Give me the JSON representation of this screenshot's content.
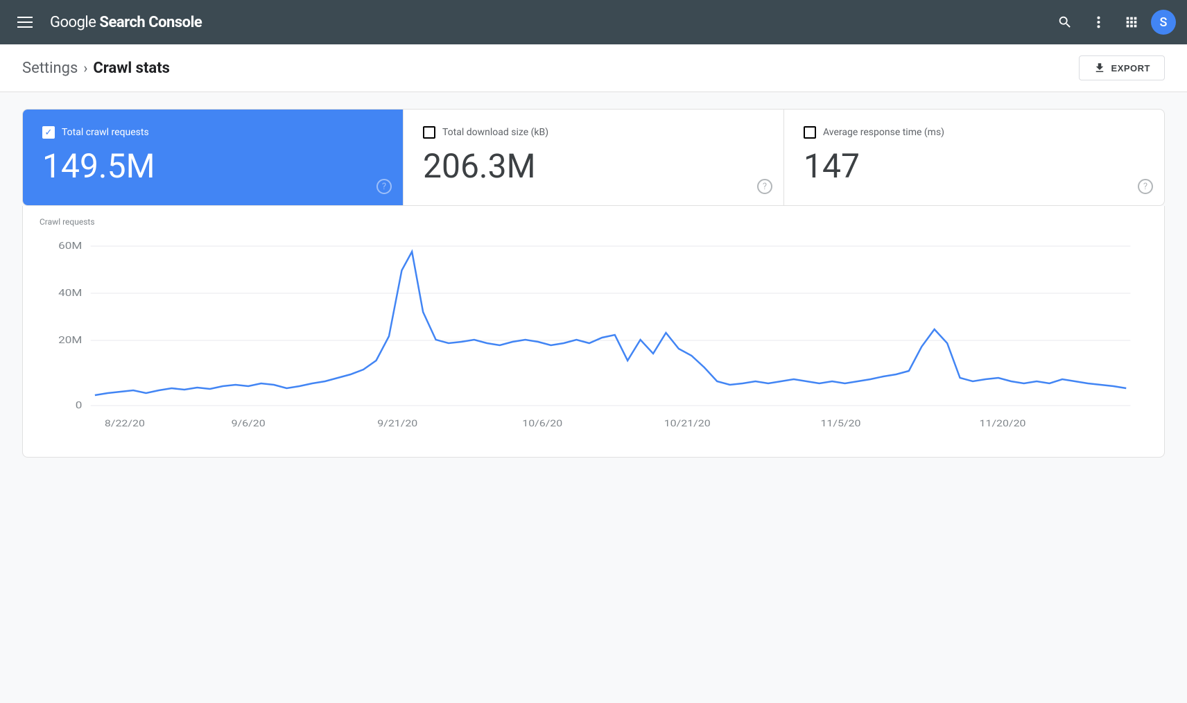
{
  "header": {
    "title_part1": "Google ",
    "title_part2": "Search Console",
    "search_label": "Search",
    "more_label": "More options",
    "apps_label": "Google apps",
    "avatar_label": "S"
  },
  "breadcrumb": {
    "settings_label": "Settings",
    "separator": ">",
    "current_label": "Crawl stats",
    "export_label": "EXPORT"
  },
  "stats": [
    {
      "id": "total_crawl_requests",
      "label": "Total crawl requests",
      "value": "149.5M",
      "active": true,
      "checked": true
    },
    {
      "id": "total_download_size",
      "label": "Total download size (kB)",
      "value": "206.3M",
      "active": false,
      "checked": false
    },
    {
      "id": "average_response_time",
      "label": "Average response time (ms)",
      "value": "147",
      "active": false,
      "checked": false
    }
  ],
  "chart": {
    "y_label": "Crawl requests",
    "y_ticks": [
      "60M",
      "40M",
      "20M",
      "0"
    ],
    "x_labels": [
      "8/22/20",
      "9/6/20",
      "9/21/20",
      "10/6/20",
      "10/21/20",
      "11/5/20",
      "11/20/20"
    ]
  }
}
